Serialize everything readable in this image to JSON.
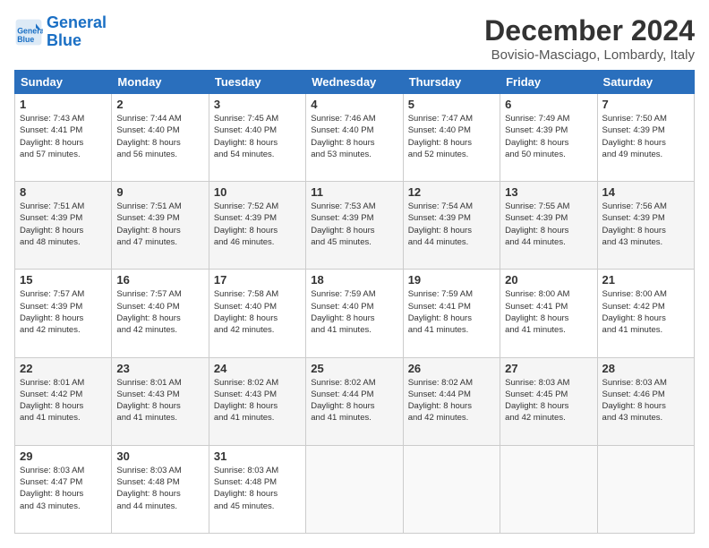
{
  "logo": {
    "line1": "General",
    "line2": "Blue"
  },
  "header": {
    "month": "December 2024",
    "location": "Bovisio-Masciago, Lombardy, Italy"
  },
  "weekdays": [
    "Sunday",
    "Monday",
    "Tuesday",
    "Wednesday",
    "Thursday",
    "Friday",
    "Saturday"
  ],
  "weeks": [
    [
      {
        "day": "1",
        "info": "Sunrise: 7:43 AM\nSunset: 4:41 PM\nDaylight: 8 hours\nand 57 minutes."
      },
      {
        "day": "2",
        "info": "Sunrise: 7:44 AM\nSunset: 4:40 PM\nDaylight: 8 hours\nand 56 minutes."
      },
      {
        "day": "3",
        "info": "Sunrise: 7:45 AM\nSunset: 4:40 PM\nDaylight: 8 hours\nand 54 minutes."
      },
      {
        "day": "4",
        "info": "Sunrise: 7:46 AM\nSunset: 4:40 PM\nDaylight: 8 hours\nand 53 minutes."
      },
      {
        "day": "5",
        "info": "Sunrise: 7:47 AM\nSunset: 4:40 PM\nDaylight: 8 hours\nand 52 minutes."
      },
      {
        "day": "6",
        "info": "Sunrise: 7:49 AM\nSunset: 4:39 PM\nDaylight: 8 hours\nand 50 minutes."
      },
      {
        "day": "7",
        "info": "Sunrise: 7:50 AM\nSunset: 4:39 PM\nDaylight: 8 hours\nand 49 minutes."
      }
    ],
    [
      {
        "day": "8",
        "info": "Sunrise: 7:51 AM\nSunset: 4:39 PM\nDaylight: 8 hours\nand 48 minutes."
      },
      {
        "day": "9",
        "info": "Sunrise: 7:51 AM\nSunset: 4:39 PM\nDaylight: 8 hours\nand 47 minutes."
      },
      {
        "day": "10",
        "info": "Sunrise: 7:52 AM\nSunset: 4:39 PM\nDaylight: 8 hours\nand 46 minutes."
      },
      {
        "day": "11",
        "info": "Sunrise: 7:53 AM\nSunset: 4:39 PM\nDaylight: 8 hours\nand 45 minutes."
      },
      {
        "day": "12",
        "info": "Sunrise: 7:54 AM\nSunset: 4:39 PM\nDaylight: 8 hours\nand 44 minutes."
      },
      {
        "day": "13",
        "info": "Sunrise: 7:55 AM\nSunset: 4:39 PM\nDaylight: 8 hours\nand 44 minutes."
      },
      {
        "day": "14",
        "info": "Sunrise: 7:56 AM\nSunset: 4:39 PM\nDaylight: 8 hours\nand 43 minutes."
      }
    ],
    [
      {
        "day": "15",
        "info": "Sunrise: 7:57 AM\nSunset: 4:39 PM\nDaylight: 8 hours\nand 42 minutes."
      },
      {
        "day": "16",
        "info": "Sunrise: 7:57 AM\nSunset: 4:40 PM\nDaylight: 8 hours\nand 42 minutes."
      },
      {
        "day": "17",
        "info": "Sunrise: 7:58 AM\nSunset: 4:40 PM\nDaylight: 8 hours\nand 42 minutes."
      },
      {
        "day": "18",
        "info": "Sunrise: 7:59 AM\nSunset: 4:40 PM\nDaylight: 8 hours\nand 41 minutes."
      },
      {
        "day": "19",
        "info": "Sunrise: 7:59 AM\nSunset: 4:41 PM\nDaylight: 8 hours\nand 41 minutes."
      },
      {
        "day": "20",
        "info": "Sunrise: 8:00 AM\nSunset: 4:41 PM\nDaylight: 8 hours\nand 41 minutes."
      },
      {
        "day": "21",
        "info": "Sunrise: 8:00 AM\nSunset: 4:42 PM\nDaylight: 8 hours\nand 41 minutes."
      }
    ],
    [
      {
        "day": "22",
        "info": "Sunrise: 8:01 AM\nSunset: 4:42 PM\nDaylight: 8 hours\nand 41 minutes."
      },
      {
        "day": "23",
        "info": "Sunrise: 8:01 AM\nSunset: 4:43 PM\nDaylight: 8 hours\nand 41 minutes."
      },
      {
        "day": "24",
        "info": "Sunrise: 8:02 AM\nSunset: 4:43 PM\nDaylight: 8 hours\nand 41 minutes."
      },
      {
        "day": "25",
        "info": "Sunrise: 8:02 AM\nSunset: 4:44 PM\nDaylight: 8 hours\nand 41 minutes."
      },
      {
        "day": "26",
        "info": "Sunrise: 8:02 AM\nSunset: 4:44 PM\nDaylight: 8 hours\nand 42 minutes."
      },
      {
        "day": "27",
        "info": "Sunrise: 8:03 AM\nSunset: 4:45 PM\nDaylight: 8 hours\nand 42 minutes."
      },
      {
        "day": "28",
        "info": "Sunrise: 8:03 AM\nSunset: 4:46 PM\nDaylight: 8 hours\nand 43 minutes."
      }
    ],
    [
      {
        "day": "29",
        "info": "Sunrise: 8:03 AM\nSunset: 4:47 PM\nDaylight: 8 hours\nand 43 minutes."
      },
      {
        "day": "30",
        "info": "Sunrise: 8:03 AM\nSunset: 4:48 PM\nDaylight: 8 hours\nand 44 minutes."
      },
      {
        "day": "31",
        "info": "Sunrise: 8:03 AM\nSunset: 4:48 PM\nDaylight: 8 hours\nand 45 minutes."
      },
      null,
      null,
      null,
      null
    ]
  ]
}
